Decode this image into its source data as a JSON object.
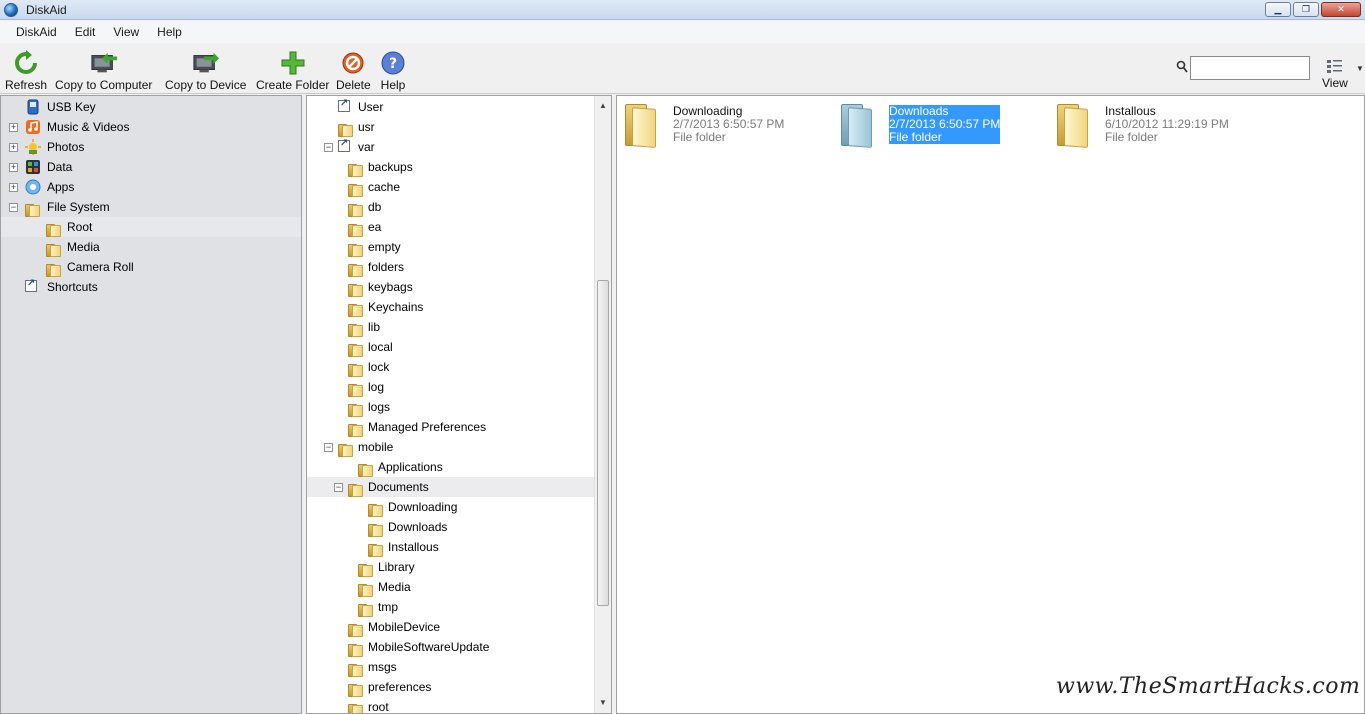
{
  "window": {
    "title": "DiskAid"
  },
  "menu": [
    "DiskAid",
    "Edit",
    "View",
    "Help"
  ],
  "toolbar": {
    "refresh": "Refresh",
    "copy_to_computer": "Copy to Computer",
    "copy_to_device": "Copy to Device",
    "create_folder": "Create Folder",
    "delete": "Delete",
    "help": "Help",
    "view": "View",
    "search_value": ""
  },
  "sidebar": {
    "items": [
      {
        "label": "USB Key",
        "icon": "usb-key-icon"
      },
      {
        "label": "Music & Videos",
        "icon": "music-icon"
      },
      {
        "label": "Photos",
        "icon": "photos-icon"
      },
      {
        "label": "Data",
        "icon": "data-icon"
      },
      {
        "label": "Apps",
        "icon": "apps-icon"
      },
      {
        "label": "File System",
        "icon": "folder-icon"
      },
      {
        "label": "Root",
        "icon": "folder-icon"
      },
      {
        "label": "Media",
        "icon": "folder-icon"
      },
      {
        "label": "Camera Roll",
        "icon": "folder-icon"
      },
      {
        "label": "Shortcuts",
        "icon": "shortcut-icon"
      }
    ]
  },
  "tree": {
    "items": [
      "User",
      "usr",
      "var",
      "backups",
      "cache",
      "db",
      "ea",
      "empty",
      "folders",
      "keybags",
      "Keychains",
      "lib",
      "local",
      "lock",
      "log",
      "logs",
      "Managed Preferences",
      "mobile",
      "Applications",
      "Documents",
      "Downloading",
      "Downloads",
      "Installous",
      "Library",
      "Media",
      "tmp",
      "MobileDevice",
      "MobileSoftwareUpdate",
      "msgs",
      "preferences",
      "root"
    ]
  },
  "files": [
    {
      "name": "Downloading",
      "date": "2/7/2013 6:50:57 PM",
      "type": "File folder"
    },
    {
      "name": "Downloads",
      "date": "2/7/2013 6:50:57 PM",
      "type": "File folder"
    },
    {
      "name": "Installous",
      "date": "6/10/2012 11:29:19 PM",
      "type": "File folder"
    }
  ],
  "watermark": "www.TheSmartHacks.com"
}
